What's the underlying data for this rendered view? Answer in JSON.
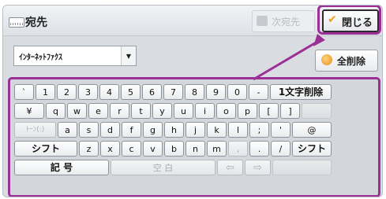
{
  "header": {
    "title": "宛先",
    "next_label": "次宛先",
    "close_label": "閉じる"
  },
  "destination": {
    "selected": "ｲﾝﾀｰﾈｯﾄﾌｧｸｽ"
  },
  "clear_all_label": "全削除",
  "keyboard": {
    "row1": [
      "`",
      "1",
      "2",
      "3",
      "4",
      "5",
      "6",
      "7",
      "8",
      "9",
      "0",
      "-"
    ],
    "delete_char_label": "1文字削除",
    "row2": [
      "¥",
      "q",
      "w",
      "e",
      "r",
      "t",
      "y",
      "u",
      "i",
      "o",
      "p",
      "[",
      "]"
    ],
    "row3_first": "ﾄｰﾝ(:)",
    "row3": [
      "a",
      "s",
      "d",
      "f",
      "g",
      "h",
      "j",
      "k",
      "l",
      ";",
      "'",
      "@"
    ],
    "shift_label": "シフト",
    "row4": [
      "z",
      "x",
      "c",
      "v",
      "b",
      "n",
      "m",
      ",",
      ".",
      "/"
    ],
    "symbols_label": "記 号",
    "space_label": "空 白",
    "left_arrow": "⇦",
    "right_arrow": "⇨"
  },
  "colors": {
    "highlight": "#9b2f95",
    "checkmark": "#f0a01c"
  }
}
